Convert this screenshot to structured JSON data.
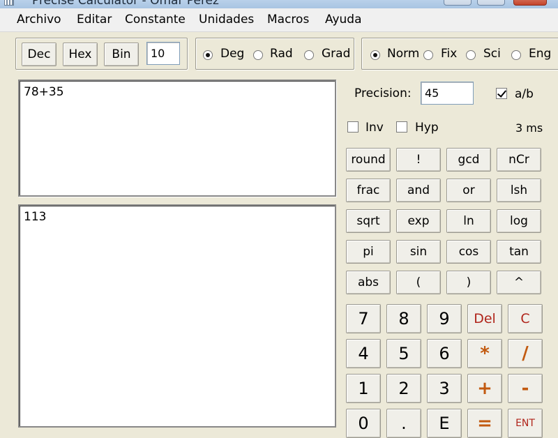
{
  "window": {
    "title": "Precise Calculator - Omar Perez"
  },
  "menu": [
    "Archivo",
    "Editar",
    "Constante",
    "Unidades",
    "Macros",
    "Ayuda"
  ],
  "base": {
    "buttons": [
      "Dec",
      "Hex",
      "Bin"
    ],
    "value": "10"
  },
  "angle": {
    "options": [
      "Deg",
      "Rad",
      "Grad"
    ],
    "selected": "Deg"
  },
  "format": {
    "options": [
      "Norm",
      "Fix",
      "Sci",
      "Eng"
    ],
    "selected": "Norm"
  },
  "expression": "78+35",
  "result": "113",
  "precision": {
    "label": "Precision:",
    "value": "45",
    "fraction_label": "a/b",
    "fraction_checked": true
  },
  "toggles": {
    "inv_label": "Inv",
    "inv_checked": false,
    "hyp_label": "Hyp",
    "hyp_checked": false,
    "time": "3 ms"
  },
  "functions": [
    [
      "round",
      "!",
      "gcd",
      "nCr"
    ],
    [
      "frac",
      "and",
      "or",
      "lsh"
    ],
    [
      "sqrt",
      "exp",
      "ln",
      "log"
    ],
    [
      "pi",
      "sin",
      "cos",
      "tan"
    ],
    [
      "abs",
      "(",
      ")",
      "^"
    ]
  ],
  "keypad": [
    [
      "7",
      "8",
      "9",
      "Del",
      "C"
    ],
    [
      "4",
      "5",
      "6",
      "*",
      "/"
    ],
    [
      "1",
      "2",
      "3",
      "+",
      "-"
    ],
    [
      "0",
      ".",
      "E",
      "=",
      "ENT"
    ]
  ],
  "colors": {
    "operator": "#c25a10",
    "control": "#b0241a",
    "background": "#ece9d8"
  }
}
